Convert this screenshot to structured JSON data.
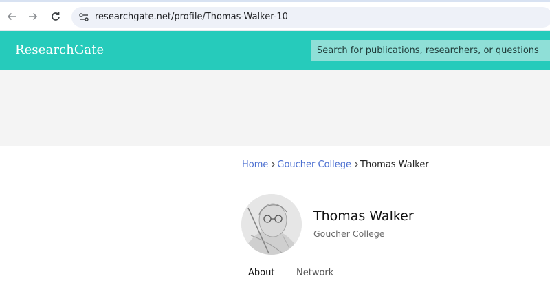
{
  "browser": {
    "url": "researchgate.net/profile/Thomas-Walker-10",
    "icons": [
      "back-arrow-icon",
      "forward-arrow-icon",
      "reload-icon",
      "site-info-icon"
    ]
  },
  "site": {
    "logo": "ResearchGate",
    "search_placeholder": "Search for publications, researchers, or questions",
    "brand_color": "#26cbbb"
  },
  "breadcrumb": {
    "items": [
      {
        "label": "Home",
        "link": true
      },
      {
        "label": "Goucher College",
        "link": true
      },
      {
        "label": "Thomas Walker",
        "link": false
      }
    ]
  },
  "profile": {
    "name": "Thomas Walker",
    "institution": "Goucher College"
  },
  "tabs": [
    {
      "label": "About",
      "active": true
    },
    {
      "label": "Network",
      "active": false
    }
  ]
}
